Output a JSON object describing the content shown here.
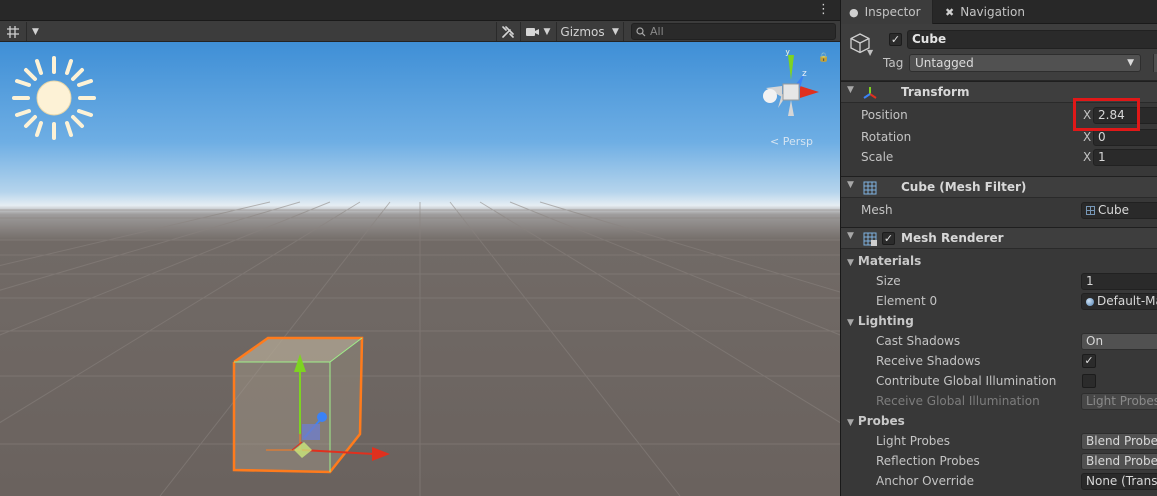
{
  "scene": {
    "gizmos_label": "Gizmos",
    "search_placeholder": "All",
    "persp_label": "< Persp",
    "axis_y": "y",
    "axis_z": "z"
  },
  "inspector": {
    "tabs": [
      {
        "label": "Inspector"
      },
      {
        "label": "Navigation"
      }
    ],
    "object": {
      "name": "Cube",
      "tag_label": "Tag",
      "tag_value": "Untagged"
    },
    "transform": {
      "title": "Transform",
      "position_label": "Position",
      "rotation_label": "Rotation",
      "scale_label": "Scale",
      "axis_label": "X",
      "position_x": "2.84",
      "rotation_x": "0",
      "scale_x": "1"
    },
    "mesh_filter": {
      "title": "Cube (Mesh Filter)",
      "mesh_label": "Mesh",
      "mesh_value": "Cube"
    },
    "mesh_renderer": {
      "title": "Mesh Renderer",
      "materials_section": "Materials",
      "size_label": "Size",
      "size_value": "1",
      "element0_label": "Element 0",
      "element0_value": "Default-Ma",
      "lighting_section": "Lighting",
      "cast_shadows_label": "Cast Shadows",
      "cast_shadows_value": "On",
      "receive_shadows_label": "Receive Shadows",
      "contribute_gi_label": "Contribute Global Illumination",
      "receive_gi_label": "Receive Global Illumination",
      "receive_gi_value": "Light Probes",
      "probes_section": "Probes",
      "light_probes_label": "Light Probes",
      "light_probes_value": "Blend Probes",
      "reflection_probes_label": "Reflection Probes",
      "reflection_probes_value": "Blend Probes",
      "anchor_override_label": "Anchor Override",
      "anchor_override_value": "None (Transf"
    }
  },
  "colors": {
    "highlight": "#e01818",
    "selection_outline": "#ff7b1c",
    "axis_x": "#e0301e",
    "axis_y": "#7ed321",
    "axis_z": "#3b82f6"
  }
}
